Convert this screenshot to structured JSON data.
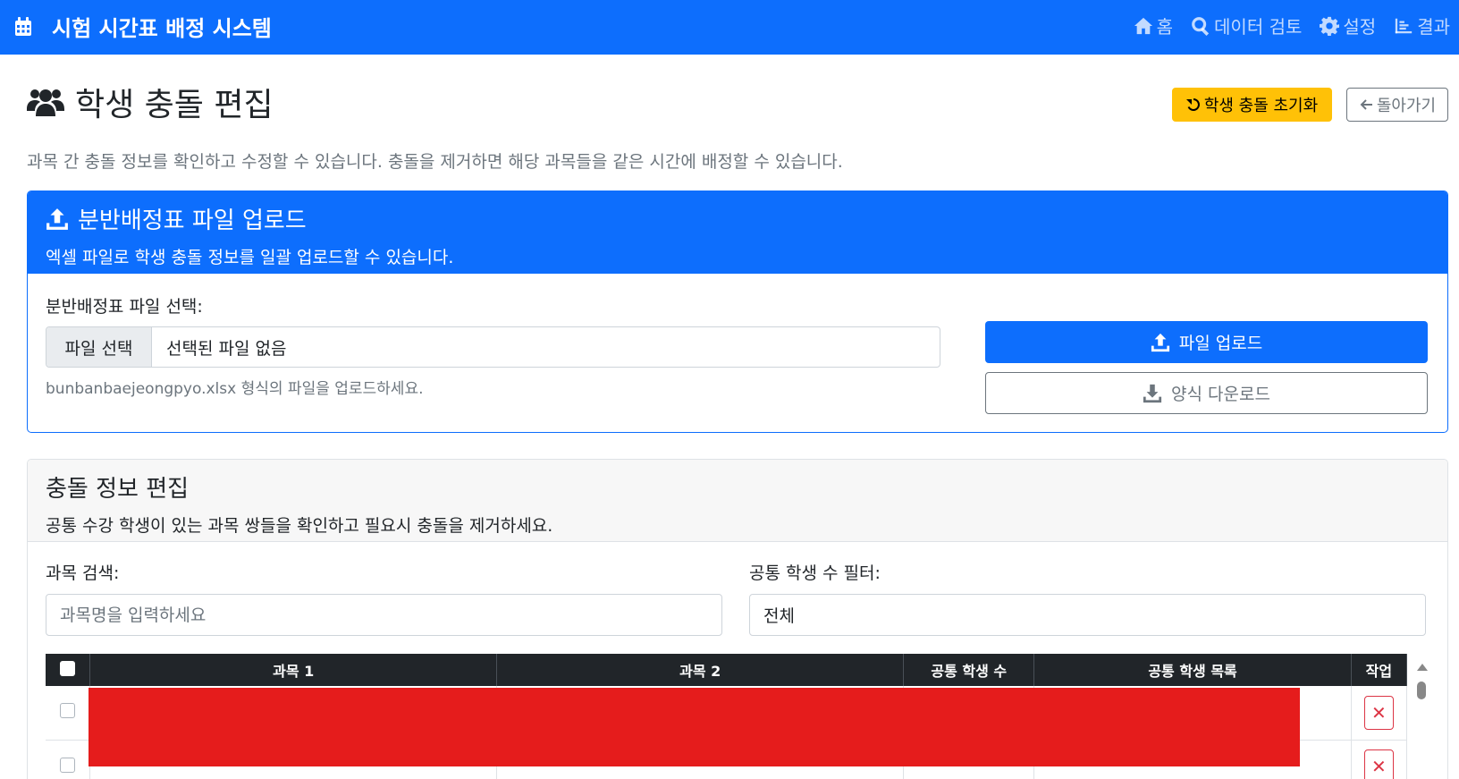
{
  "navbar": {
    "brand": "시험 시간표 배정 시스템",
    "links": [
      {
        "label": "홈",
        "icon": "home-icon"
      },
      {
        "label": "데이터 검토",
        "icon": "search-icon"
      },
      {
        "label": "설정",
        "icon": "gear-icon"
      },
      {
        "label": "결과",
        "icon": "chart-icon"
      }
    ],
    "color": "#0d6efd"
  },
  "page": {
    "title": "학생 충돌 편집",
    "reset_button": "학생 충돌 초기화",
    "back_button": "돌아가기",
    "lead": "과목 간 충돌 정보를 확인하고 수정할 수 있습니다. 충돌을 제거하면 해당 과목들을 같은 시간에 배정할 수 있습니다."
  },
  "upload_card": {
    "title": "분반배정표 파일 업로드",
    "subtitle": "엑셀 파일로 학생 충돌 정보를 일괄 업로드할 수 있습니다.",
    "file_label": "분반배정표 파일 선택:",
    "file_button": "파일 선택",
    "file_status": "선택된 파일 없음",
    "file_help": "bunbanbaejeongpyo.xlsx 형식의 파일을 업로드하세요.",
    "upload_button": "파일 업로드",
    "download_button": "양식 다운로드"
  },
  "conflict_card": {
    "title": "충돌 정보 편집",
    "subtitle": "공통 수강 학생이 있는 과목 쌍들을 확인하고 필요시 충돌을 제거하세요.",
    "search_label": "과목 검색:",
    "search_placeholder": "과목명을 입력하세요",
    "filter_label": "공통 학생 수 필터:",
    "filter_value": "전체",
    "table": {
      "columns": [
        "과목 1",
        "과목 2",
        "공통 학생 수",
        "공통 학생 목록",
        "작업"
      ],
      "delete_symbol": "✕"
    }
  },
  "colors": {
    "primary": "#0d6efd",
    "warning": "#ffc107",
    "danger": "#dc3545",
    "dark": "#212529",
    "redaction": "#e51c1c"
  }
}
